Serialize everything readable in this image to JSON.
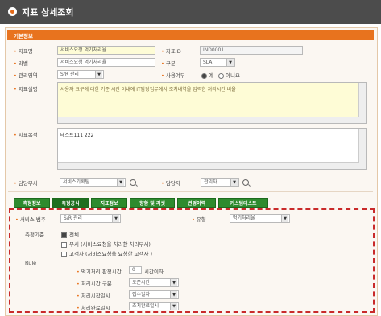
{
  "window": {
    "title": "지표 상세조회"
  },
  "section": {
    "title": "기본정보"
  },
  "fields": {
    "indicator_name": {
      "label": "지표명",
      "value": "서비스요청 먹기처리율"
    },
    "indicator_id": {
      "label": "지표ID",
      "value": "IND0001"
    },
    "alias": {
      "label": "라벨",
      "value": "서비스요청 먹기처리율"
    },
    "category": {
      "label": "구분",
      "value": "SLA"
    },
    "admin_area": {
      "label": "관리영역",
      "value": "S/R 관리"
    },
    "usage": {
      "label": "사용여부",
      "options": [
        "예",
        "아니요"
      ],
      "selected": "예"
    },
    "description": {
      "label": "지표설명",
      "value": "사용자 요구에 대한 기준 시간 이내에 IT담당업무에서 조치내역을 입력한 처리시간 비율"
    },
    "purpose": {
      "label": "지표목적",
      "value": "테스트111 222"
    },
    "department": {
      "label": "담당부서",
      "value": "서비스기획팀"
    },
    "manager": {
      "label": "담당자",
      "value": "관리자"
    }
  },
  "tabs": [
    "측정정보",
    "측정공식",
    "지표정보",
    "향함 및 리셋",
    "변경이력",
    "커스텀테스트"
  ],
  "active_tab": "측정공식",
  "formula": {
    "service_scope": {
      "label": "서비스 범주",
      "value": "S/R 관리"
    },
    "type": {
      "label": "유형",
      "value": "먹기처리율"
    },
    "criteria_label": "측정기준",
    "criteria_options": [
      {
        "label": "전체",
        "checked": true
      },
      {
        "label": "부서 (서비스요청을 처리한 처리부서)",
        "checked": false
      },
      {
        "label": "고객사 (서비스요청을 요청한 고객사 )",
        "checked": false
      }
    ],
    "rule_label": "Rule",
    "rules": [
      {
        "label": "먹기처리 판정시간",
        "value": "0",
        "suffix": "시간이하"
      },
      {
        "label": "처리시간 구분",
        "value": "오픈시간"
      },
      {
        "label": "처리시작일시",
        "value": "접수일자"
      },
      {
        "label": "처리완료일시",
        "value": "조치완료일시"
      }
    ]
  },
  "colors": {
    "accent": "#e8731e",
    "tab_green": "#2e8b2e",
    "highlight_border": "#c92a2a"
  },
  "icons": {
    "window": "orange-circle-icon",
    "lookup": "magnifier-icon"
  }
}
